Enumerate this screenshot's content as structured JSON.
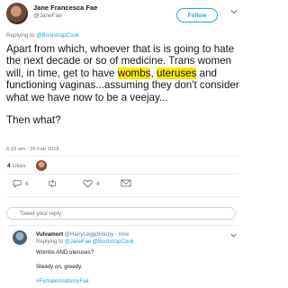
{
  "tweet": {
    "author_name": "Jane Francesca Fae",
    "author_handle": "@JaneFae",
    "follow_label": "Follow",
    "replying_prefix": "Replying to",
    "replying_to": "@BootstrapCook",
    "text_part1": "Apart from which, whoever that is is going to hate the next decade or so of medicine. Trans women will, in time, get to have ",
    "hl1": "wombs",
    "comma": ",",
    "hl2": "uteruses",
    "text_part2": " and functioning vaginas...assuming they don't consider what we have now to be a veejay...",
    "text_then": "Then what?",
    "timestamp": "6:19 am - 26 Feb 2018",
    "likes_count": "4",
    "likes_label": "Likes",
    "reply_count": "6",
    "retweet_count": "",
    "like_action_count": "4"
  },
  "reply_box": {
    "placeholder": "Tweet your reply"
  },
  "reply": {
    "author_name": "Vulvamort",
    "meta": "@HairyLeggdHarpy · now",
    "replying_prefix": "Replying to",
    "replying_to": "@JaneFae @BootstrapCook",
    "line1": "Wombs AND uteruses?",
    "line2": "Steady on, greedy.",
    "hashtag": "#FemaleAnatomyFail"
  },
  "colors": {
    "accent": "#1da1f2",
    "highlight": "#ffe600",
    "like": "#e0245e"
  }
}
